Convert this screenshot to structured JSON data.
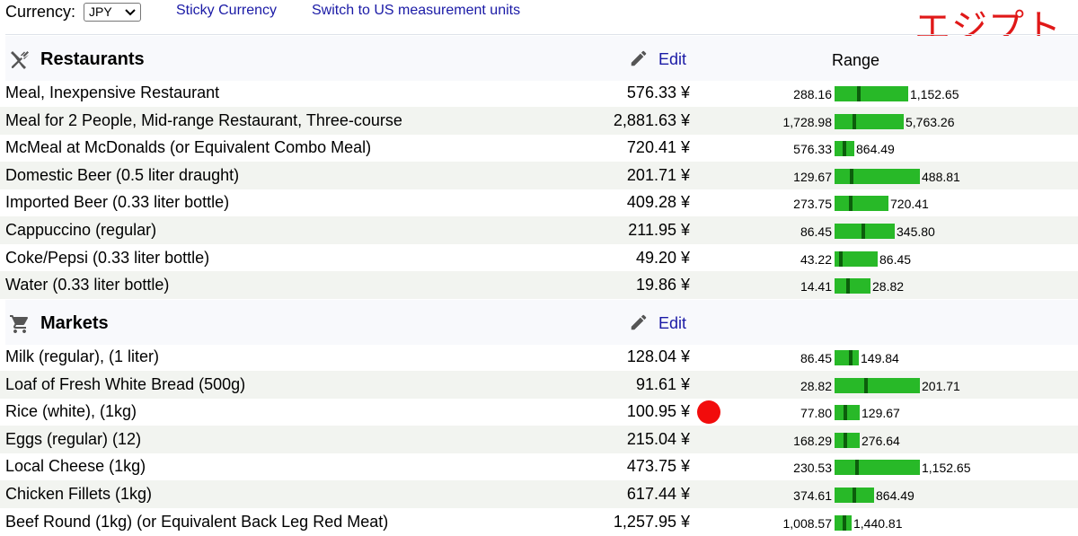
{
  "toolbar": {
    "currency_label": "Currency:",
    "currency_selected": "JPY",
    "sticky_currency_label": "Sticky Currency",
    "units_switch_label": "Switch to US measurement units"
  },
  "page_title_jp": "エジプト",
  "colors": {
    "link": "#1a1aa6",
    "bar": "#28b928",
    "bar_marker": "#0c5e0c",
    "title_red": "#e01818",
    "dot_red": "#f20c0c"
  },
  "sections": [
    {
      "title": "Restaurants",
      "icon": "utensils-icon",
      "edit_label": "Edit",
      "range_label": "Range",
      "items": [
        {
          "name": "Meal, Inexpensive Restaurant",
          "price": "576.33 ¥",
          "min": "288.16",
          "max": "1,152.65",
          "min_v": 288.16,
          "max_v": 1152.65,
          "avg_v": 576.33
        },
        {
          "name": "Meal for 2 People, Mid-range Restaurant, Three-course",
          "price": "2,881.63 ¥",
          "min": "1,728.98",
          "max": "5,763.26",
          "min_v": 1728.98,
          "max_v": 5763.26,
          "avg_v": 2881.63
        },
        {
          "name": "McMeal at McDonalds (or Equivalent Combo Meal)",
          "price": "720.41 ¥",
          "min": "576.33",
          "max": "864.49",
          "min_v": 576.33,
          "max_v": 864.49,
          "avg_v": 720.41
        },
        {
          "name": "Domestic Beer (0.5 liter draught)",
          "price": "201.71 ¥",
          "min": "129.67",
          "max": "488.81",
          "min_v": 129.67,
          "max_v": 488.81,
          "avg_v": 201.71
        },
        {
          "name": "Imported Beer (0.33 liter bottle)",
          "price": "409.28 ¥",
          "min": "273.75",
          "max": "720.41",
          "min_v": 273.75,
          "max_v": 720.41,
          "avg_v": 409.28
        },
        {
          "name": "Cappuccino (regular)",
          "price": "211.95 ¥",
          "min": "86.45",
          "max": "345.80",
          "min_v": 86.45,
          "max_v": 345.8,
          "avg_v": 211.95
        },
        {
          "name": "Coke/Pepsi (0.33 liter bottle)",
          "price": "49.20 ¥",
          "min": "43.22",
          "max": "86.45",
          "min_v": 43.22,
          "max_v": 86.45,
          "avg_v": 49.2
        },
        {
          "name": "Water (0.33 liter bottle)",
          "price": "19.86 ¥",
          "min": "14.41",
          "max": "28.82",
          "min_v": 14.41,
          "max_v": 28.82,
          "avg_v": 19.86
        }
      ]
    },
    {
      "title": "Markets",
      "icon": "shopping-cart-icon",
      "edit_label": "Edit",
      "items": [
        {
          "name": "Milk (regular), (1 liter)",
          "price": "128.04 ¥",
          "min": "86.45",
          "max": "149.84",
          "min_v": 86.45,
          "max_v": 149.84,
          "avg_v": 128.04
        },
        {
          "name": "Loaf of Fresh White Bread (500g)",
          "price": "91.61 ¥",
          "min": "28.82",
          "max": "201.71",
          "min_v": 28.82,
          "max_v": 201.71,
          "avg_v": 91.61
        },
        {
          "name": "Rice (white), (1kg)",
          "price": "100.95 ¥",
          "min": "77.80",
          "max": "129.67",
          "min_v": 77.8,
          "max_v": 129.67,
          "avg_v": 100.95,
          "has_dot": true
        },
        {
          "name": "Eggs (regular) (12)",
          "price": "215.04 ¥",
          "min": "168.29",
          "max": "276.64",
          "min_v": 168.29,
          "max_v": 276.64,
          "avg_v": 215.04
        },
        {
          "name": "Local Cheese (1kg)",
          "price": "473.75 ¥",
          "min": "230.53",
          "max": "1,152.65",
          "min_v": 230.53,
          "max_v": 1152.65,
          "avg_v": 473.75
        },
        {
          "name": "Chicken Fillets (1kg)",
          "price": "617.44 ¥",
          "min": "374.61",
          "max": "864.49",
          "min_v": 374.61,
          "max_v": 864.49,
          "avg_v": 617.44
        },
        {
          "name": "Beef Round (1kg) (or Equivalent Back Leg Red Meat)",
          "price": "1,257.95 ¥",
          "min": "1,008.57",
          "max": "1,440.81",
          "min_v": 1008.57,
          "max_v": 1440.81,
          "avg_v": 1257.95
        }
      ]
    }
  ]
}
